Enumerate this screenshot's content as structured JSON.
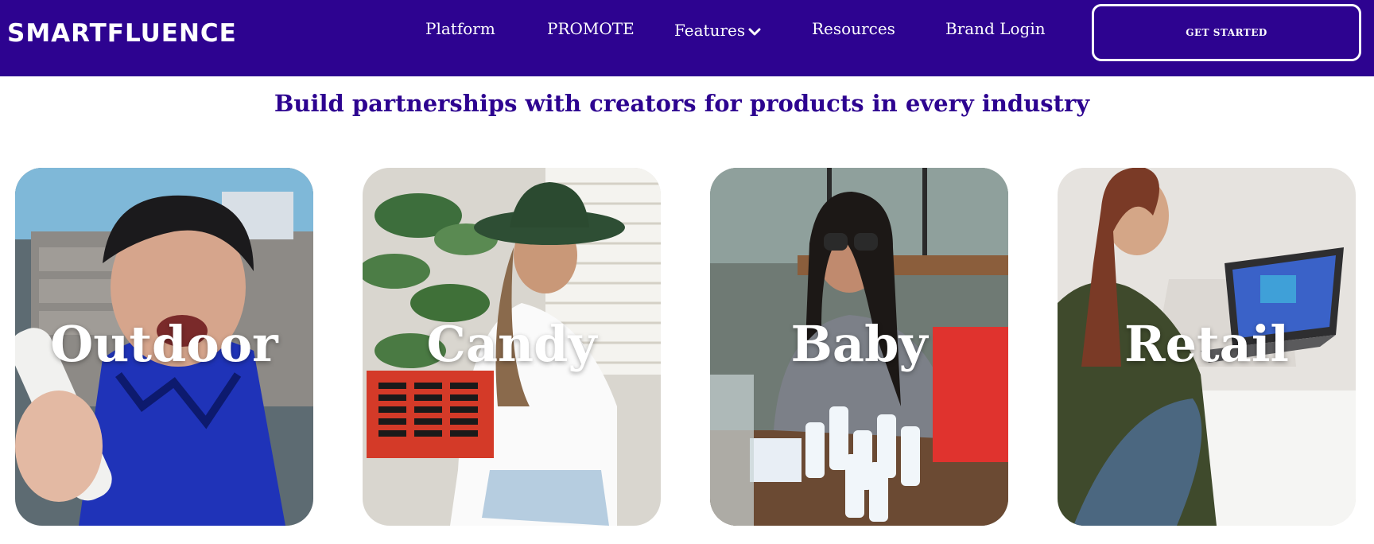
{
  "brand": {
    "logo_text": "SMARTFLUENCE"
  },
  "nav": {
    "platform": "Platform",
    "promote": "PROMOTE",
    "features": "Features",
    "features_icon": "chevron-down-icon",
    "resources": "Resources",
    "brand_login": "Brand Login"
  },
  "cta": {
    "label": "GET STARTED"
  },
  "hero": {
    "tagline": "Build partnerships with creators for products in every industry"
  },
  "categories": [
    {
      "label": "Outdoor"
    },
    {
      "label": "Candy"
    },
    {
      "label": "Baby"
    },
    {
      "label": "Retail"
    }
  ],
  "colors": {
    "nav_bg": "#2d0390",
    "tagline": "#2d0390",
    "text_on_dark": "#ffffff"
  }
}
